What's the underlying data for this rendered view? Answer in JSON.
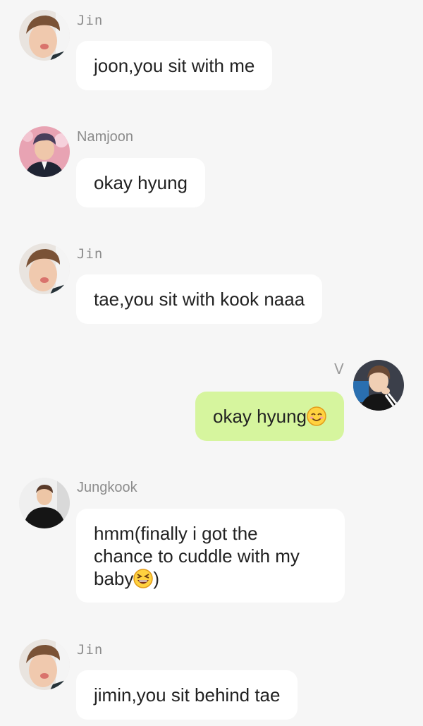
{
  "messages": [
    {
      "sender": "Jin",
      "text": "joon,you sit with me"
    },
    {
      "sender": "Namjoon",
      "text": "okay hyung"
    },
    {
      "sender": "Jin",
      "text": "tae,you sit with kook naaa"
    },
    {
      "sender": "V",
      "text": "okay hyung",
      "emoji": "smiling-face-emoji"
    },
    {
      "sender": "Jungkook",
      "text_before": "hmm(finally i got the\nchance to cuddle with my\nbaby",
      "emoji": "grinning-squinting-face-emoji",
      "text_after": ")"
    },
    {
      "sender": "Jin",
      "text": "jimin,you sit behind tae"
    }
  ],
  "colors": {
    "background": "#f6f6f6",
    "incoming_bubble": "#ffffff",
    "outgoing_bubble": "#d6f59e",
    "sender_name": "#8c8c8c",
    "message_text": "#222222"
  }
}
